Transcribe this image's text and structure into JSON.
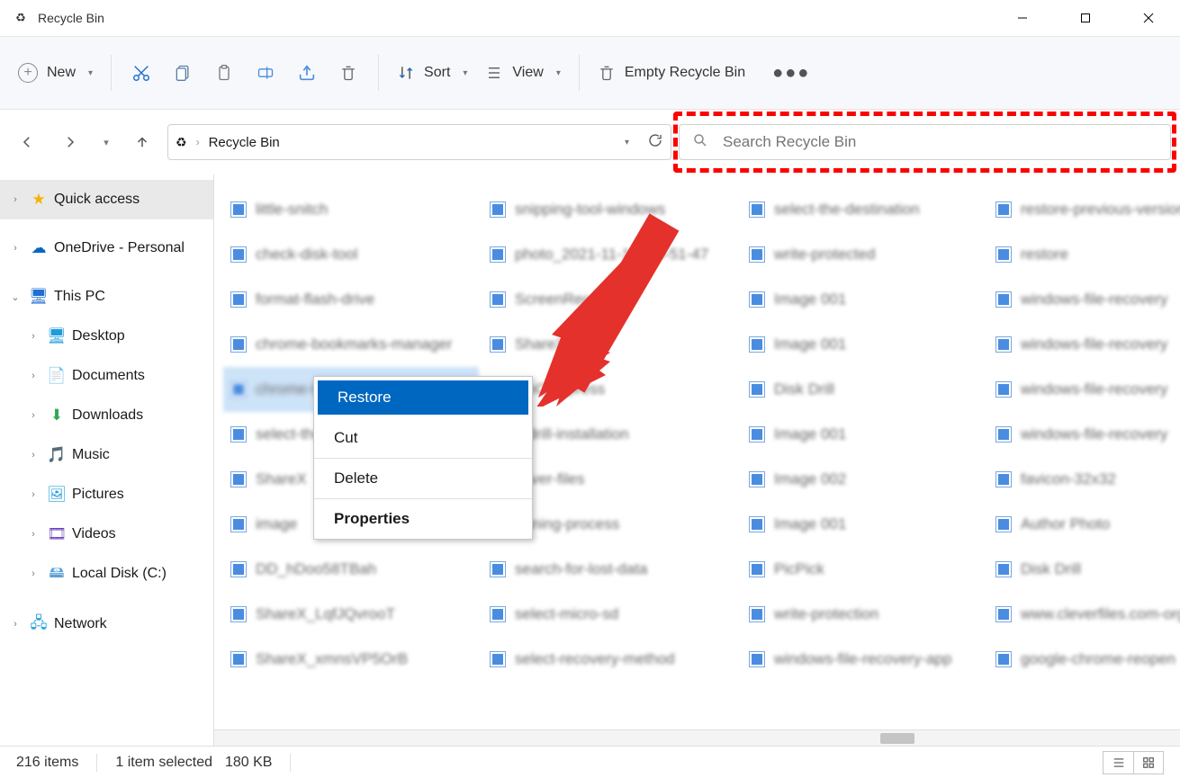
{
  "window": {
    "title": "Recycle Bin"
  },
  "toolbar": {
    "new_label": "New",
    "sort_label": "Sort",
    "view_label": "View",
    "empty_label": "Empty Recycle Bin"
  },
  "address": {
    "path": "Recycle Bin"
  },
  "search": {
    "placeholder": "Search Recycle Bin"
  },
  "sidebar": {
    "quick_access": "Quick access",
    "onedrive": "OneDrive - Personal",
    "this_pc": "This PC",
    "desktop": "Desktop",
    "documents": "Documents",
    "downloads": "Downloads",
    "music": "Music",
    "pictures": "Pictures",
    "videos": "Videos",
    "local_disk": "Local Disk (C:)",
    "network": "Network"
  },
  "files": {
    "col1": [
      "little-snitch",
      "check-disk-tool",
      "format-flash-drive",
      "chrome-bookmarks-manager",
      "chrome-bookmarks-tab",
      "select-the",
      "ShareX",
      "image",
      "DD_hDoo58TBah",
      "ShareX_LqfJQvrooT",
      "ShareX_xmnsVP5OrB"
    ],
    "col2": [
      "snipping-tool-windows",
      "photo_2021-11-1__10-51-47",
      "ScreenRec",
      "ShareX",
      "tchCompress",
      "k-drill-installation",
      "cover-files",
      "anning-process",
      "search-for-lost-data",
      "select-micro-sd",
      "select-recovery-method"
    ],
    "col3": [
      "select-the-destination",
      "write-protected",
      "Image 001",
      "Image 001",
      "Disk Drill",
      "Image 001",
      "Image 002",
      "Image 001",
      "PicPick",
      "write-protection",
      "windows-file-recovery-app"
    ],
    "col4": [
      "restore-previous-version",
      "restore",
      "windows-file-recovery",
      "windows-file-recovery",
      "windows-file-recovery",
      "windows-file-recovery",
      "favicon-32x32",
      "Author Photo",
      "Disk Drill",
      "www.cleverfiles.com-org",
      "google-chrome-reopen"
    ],
    "selected_index_col1": 4
  },
  "context_menu": {
    "items": [
      "Restore",
      "Cut",
      "Delete",
      "Properties"
    ],
    "selected": "Restore",
    "bold": "Properties"
  },
  "status": {
    "count": "216 items",
    "selection": "1 item selected",
    "size": "180 KB"
  },
  "annotation": {
    "arrow_target": "context-menu-restore",
    "dashed_highlight_target": "search-box"
  }
}
